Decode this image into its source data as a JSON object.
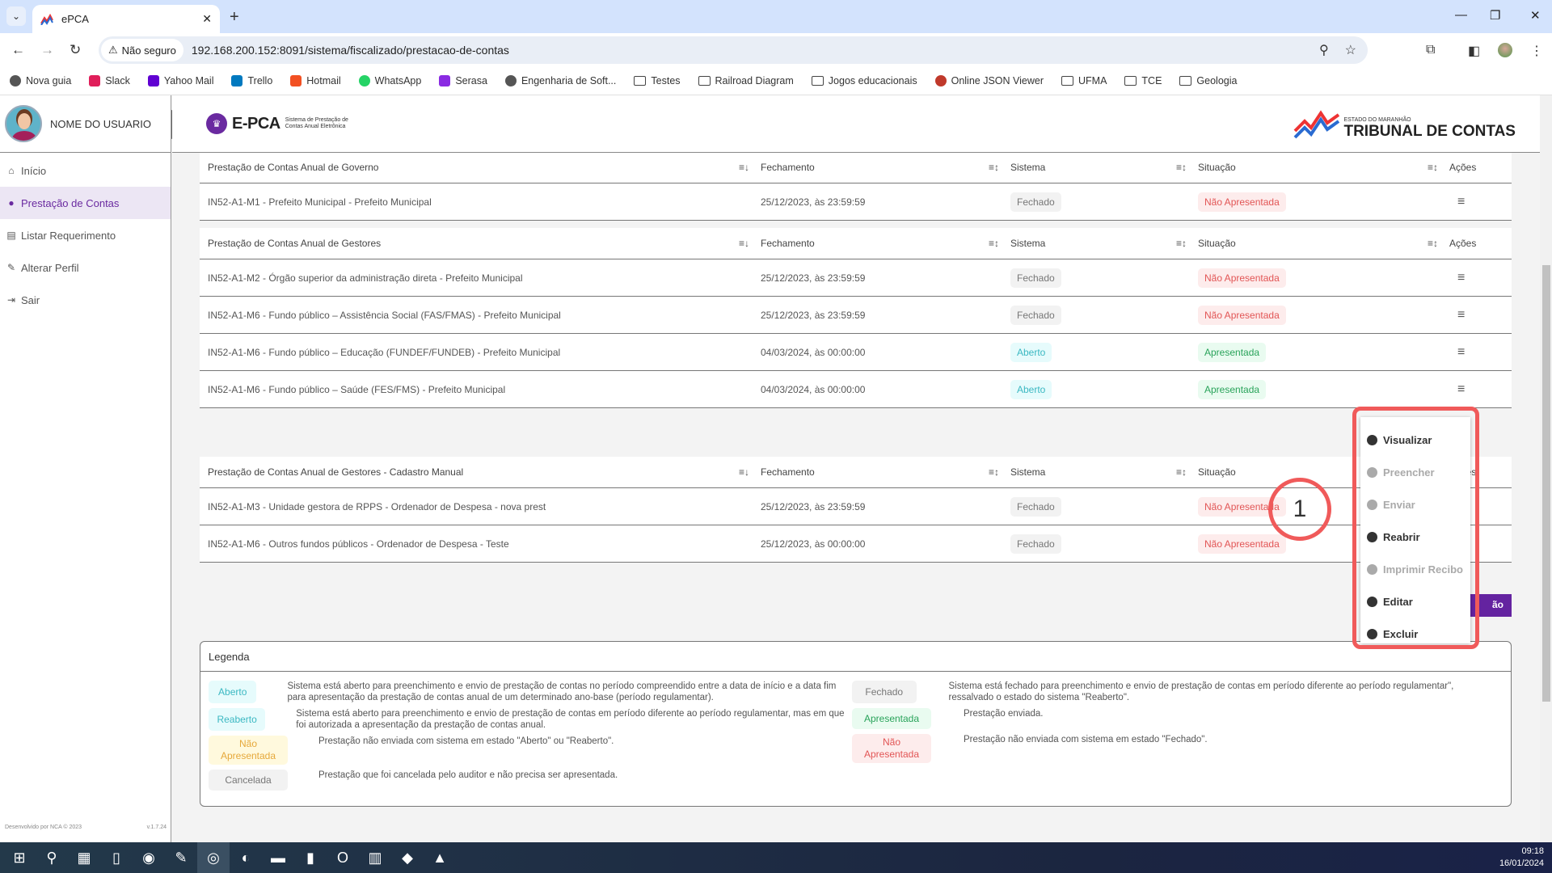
{
  "browser": {
    "tab_title": "ePCA",
    "new_tab_icon": "plus-icon",
    "security_label": "Não seguro",
    "url": "192.168.200.152:8091/sistema/fiscalizado/prestacao-de-contas",
    "bookmarks": [
      {
        "label": "Nova guia",
        "icon": "globe-icon",
        "color": "#555555"
      },
      {
        "label": "Slack",
        "icon": "slack-icon",
        "color": "#e01e5a"
      },
      {
        "label": "Yahoo Mail",
        "icon": "mail-icon",
        "color": "#6001d2"
      },
      {
        "label": "Trello",
        "icon": "trello-icon",
        "color": "#0079bf"
      },
      {
        "label": "Hotmail",
        "icon": "microsoft-icon",
        "color": "#f25022"
      },
      {
        "label": "WhatsApp",
        "icon": "whatsapp-icon",
        "color": "#25d366"
      },
      {
        "label": "Serasa",
        "icon": "serasa-icon",
        "color": "#8a2be2"
      },
      {
        "label": "Engenharia de Soft...",
        "icon": "globe-icon",
        "color": "#555555"
      },
      {
        "label": "Testes",
        "icon": "folder-icon",
        "color": ""
      },
      {
        "label": "Railroad Diagram",
        "icon": "folder-icon",
        "color": ""
      },
      {
        "label": "Jogos educacionais",
        "icon": "folder-icon",
        "color": ""
      },
      {
        "label": "Online JSON Viewer",
        "icon": "json-viewer-icon",
        "color": "#c0392b"
      },
      {
        "label": "UFMA",
        "icon": "folder-icon",
        "color": ""
      },
      {
        "label": "TCE",
        "icon": "folder-icon",
        "color": ""
      },
      {
        "label": "Geologia",
        "icon": "folder-icon",
        "color": ""
      }
    ]
  },
  "sidebar": {
    "user_name": "NOME DO USUARIO",
    "items": [
      {
        "label": "Início",
        "icon": "home-icon",
        "glyph": "⌂",
        "active": false
      },
      {
        "label": "Prestação de Contas",
        "icon": "user-accounts-icon",
        "glyph": "●",
        "active": true
      },
      {
        "label": "Listar Requerimento",
        "icon": "document-icon",
        "glyph": "▤",
        "active": false
      },
      {
        "label": "Alterar Perfil",
        "icon": "user-edit-icon",
        "glyph": "✎",
        "active": false
      },
      {
        "label": "Sair",
        "icon": "logout-icon",
        "glyph": "⇥",
        "active": false
      }
    ],
    "footer_left": "Desenvolvido por NCA © 2023",
    "footer_right": "v.1.7.24"
  },
  "header": {
    "logo_text": "E-PCA",
    "logo_sub_1": "Sistema de Prestação de",
    "logo_sub_2": "Contas Anual Eletrônica",
    "tce_small": "ESTADO DO MARANHÃO",
    "tce_big": "TRIBUNAL DE CONTAS"
  },
  "tables": [
    {
      "title": "Prestação de Contas Anual de Governo",
      "headers": [
        "Fechamento",
        "Sistema",
        "Situação",
        "Ações"
      ],
      "rows": [
        {
          "name": "IN52-A1-M1 - Prefeito Municipal - Prefeito Municipal",
          "fechamento": "25/12/2023, às 23:59:59",
          "sistema": "Fechado",
          "situacao": "Não Apresentada"
        }
      ]
    },
    {
      "title": "Prestação de Contas Anual de Gestores",
      "headers": [
        "Fechamento",
        "Sistema",
        "Situação",
        "Ações"
      ],
      "rows": [
        {
          "name": "IN52-A1-M2 - Órgão superior da administração direta - Prefeito Municipal",
          "fechamento": "25/12/2023, às 23:59:59",
          "sistema": "Fechado",
          "situacao": "Não Apresentada"
        },
        {
          "name": "IN52-A1-M6 - Fundo público – Assistência Social (FAS/FMAS) - Prefeito Municipal",
          "fechamento": "25/12/2023, às 23:59:59",
          "sistema": "Fechado",
          "situacao": "Não Apresentada"
        },
        {
          "name": "IN52-A1-M6 - Fundo público – Educação (FUNDEF/FUNDEB) - Prefeito Municipal",
          "fechamento": "04/03/2024, às 00:00:00",
          "sistema": "Aberto",
          "situacao": "Apresentada"
        },
        {
          "name": "IN52-A1-M6 - Fundo público – Saúde (FES/FMS) - Prefeito Municipal",
          "fechamento": "04/03/2024, às 00:00:00",
          "sistema": "Aberto",
          "situacao": "Apresentada"
        }
      ]
    },
    {
      "title": "Prestação de Contas Anual de Gestores - Cadastro Manual",
      "headers": [
        "Fechamento",
        "Sistema",
        "Situação",
        "Ações"
      ],
      "rows": [
        {
          "name": "IN52-A1-M3 - Unidade gestora de RPPS - Ordenador de Despesa - nova prest",
          "fechamento": "25/12/2023, às 23:59:59",
          "sistema": "Fechado",
          "situacao": "Não Apresentada"
        },
        {
          "name": "IN52-A1-M6 - Outros fundos públicos - Ordenador de Despesa - Teste",
          "fechamento": "25/12/2023, às 00:00:00",
          "sistema": "Fechado",
          "situacao": "Não Apresentada"
        }
      ]
    }
  ],
  "partial_button_label": "ão",
  "actions_menu": {
    "items": [
      {
        "label": "Visualizar",
        "enabled": true
      },
      {
        "label": "Preencher",
        "enabled": false
      },
      {
        "label": "Enviar",
        "enabled": false
      },
      {
        "label": "Reabrir",
        "enabled": true
      },
      {
        "label": "Imprimir Recibo",
        "enabled": false
      },
      {
        "label": "Editar",
        "enabled": true
      },
      {
        "label": "Excluir",
        "enabled": true
      }
    ]
  },
  "annotation": {
    "step_number": "1",
    "color": "#f05a5a"
  },
  "legend": {
    "title": "Legenda",
    "left": [
      {
        "badge": "Aberto",
        "class": "b-aberto",
        "text": "Sistema está aberto para preenchimento e envio de prestação de contas no período compreendido entre a data de início e a data fim para apresentação da prestação de contas anual de um determinado ano-base (período regulamentar)."
      },
      {
        "badge": "Reaberto",
        "class": "b-reaberto",
        "text": "Sistema está aberto para preenchimento e envio de prestação de contas em período diferente ao período regulamentar, mas em que foi autorizada a apresentação da prestação de contas anual."
      },
      {
        "badge": "Não Apresentada",
        "class": "b-naoapres-y",
        "text": "Prestação não enviada com sistema em estado \"Aberto\" ou \"Reaberto\"."
      },
      {
        "badge": "Cancelada",
        "class": "b-cancel",
        "text": "Prestação que foi cancelada pelo auditor e não precisa ser apresentada."
      }
    ],
    "right": [
      {
        "badge": "Fechado",
        "class": "b-fechado",
        "text": "Sistema está fechado para preenchimento e envio de prestação de contas em período diferente ao período regulamentar\", ressalvado o estado do sistema \"Reaberto\"."
      },
      {
        "badge": "Apresentada",
        "class": "b-apres",
        "text": "Prestação enviada."
      },
      {
        "badge": "Não Apresentada",
        "class": "b-nao",
        "text": "Prestação não enviada com sistema em estado \"Fechado\"."
      }
    ]
  },
  "taskbar": {
    "apps": [
      "start-icon",
      "search-icon",
      "task-view-icon",
      "notepad-icon",
      "app-icon",
      "paint-icon",
      "chrome-icon",
      "firefox-icon",
      "file-explorer-icon",
      "terminal-icon",
      "opera-icon",
      "calculator-icon",
      "anydesk-icon",
      "app-installer-icon"
    ],
    "time": "09:18",
    "date": "16/01/2024"
  },
  "status_colors": {
    "accent": "#6a2aa0",
    "fechado": "#777777",
    "nao_apresentada": "#e25555",
    "aberto": "#3bb8c2",
    "apresentada": "#29a35a"
  }
}
